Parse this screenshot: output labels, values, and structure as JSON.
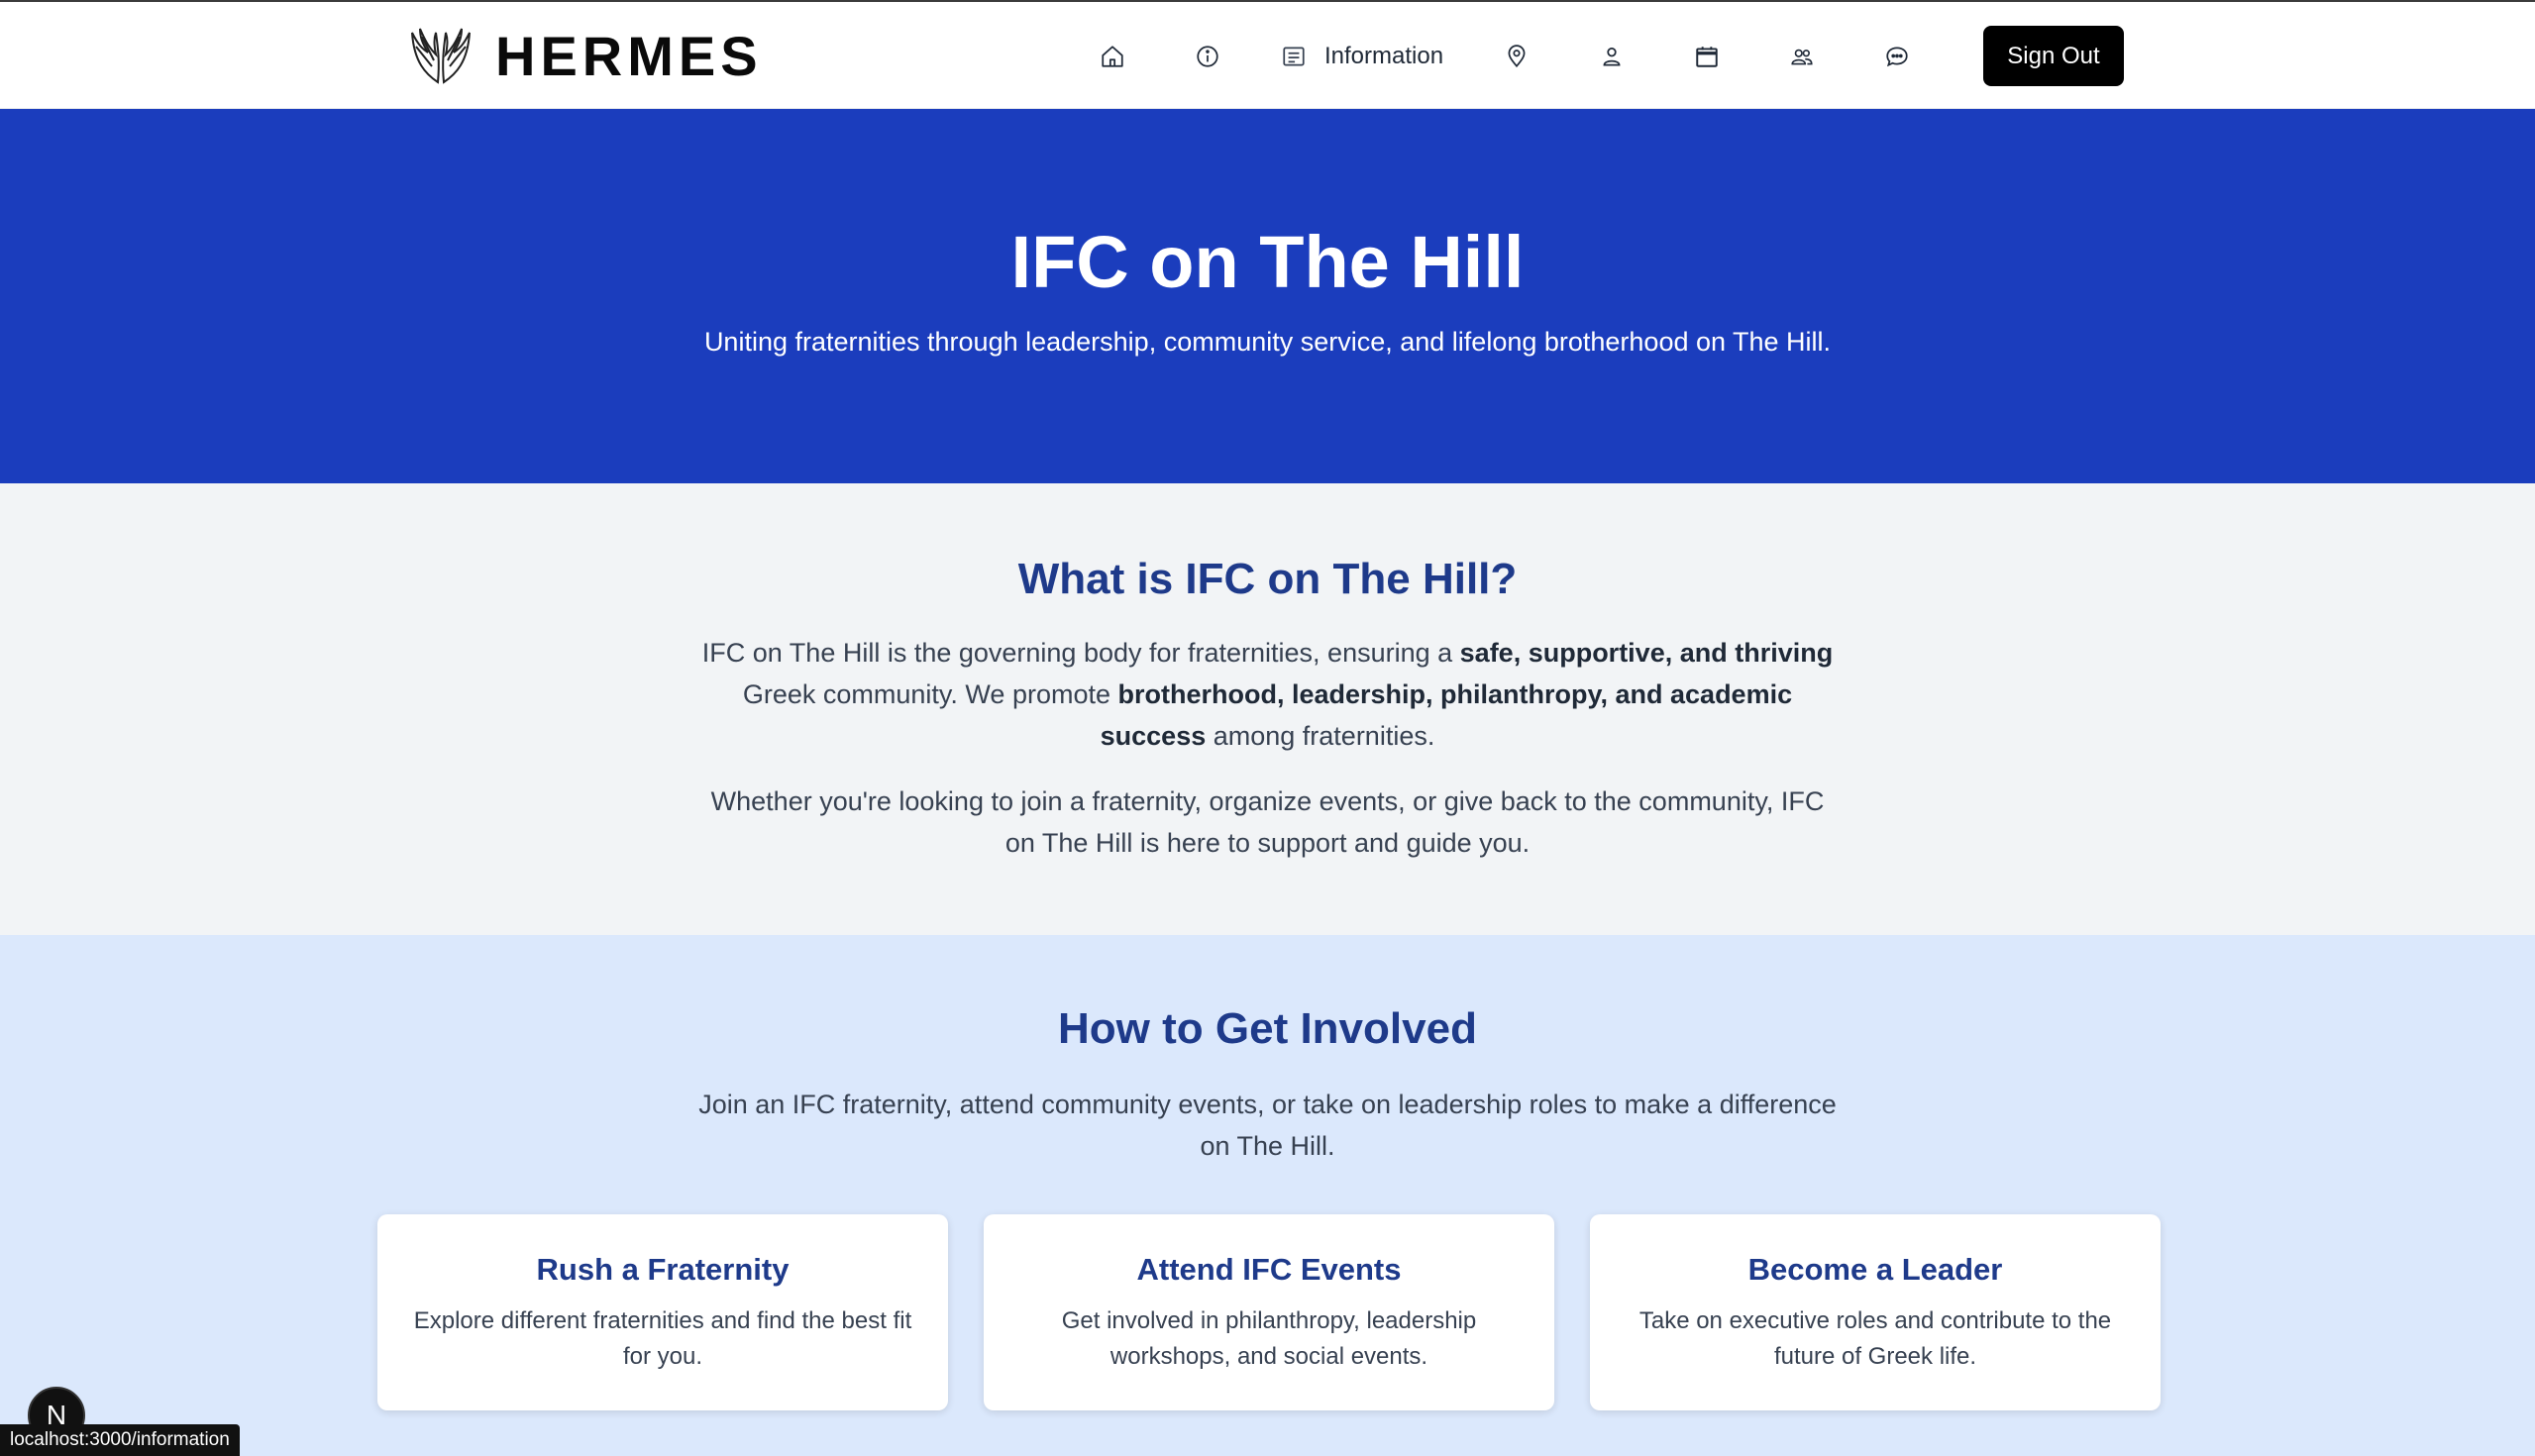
{
  "nav": {
    "logo_text": "HERMES",
    "information_label": "Information",
    "sign_out_label": "Sign Out",
    "icons": [
      "home-icon",
      "info-icon",
      "information-icon",
      "location-icon",
      "profile-icon",
      "calendar-icon",
      "groups-icon",
      "chat-icon"
    ]
  },
  "hero": {
    "title": "IFC on The Hill",
    "subtitle": "Uniting fraternities through leadership, community service, and lifelong brotherhood on The Hill."
  },
  "about": {
    "title": "What is IFC on The Hill?",
    "p1_a": "IFC on The Hill is the governing body for fraternities, ensuring a ",
    "p1_b": "safe, supportive, and thriving",
    "p1_c": " Greek community. We promote ",
    "p1_d": "brotherhood, leadership, philanthropy, and academic success",
    "p1_e": " among fraternities.",
    "p2": "Whether you're looking to join a fraternity, organize events, or give back to the community, IFC on The Hill is here to support and guide you."
  },
  "involved": {
    "title": "How to Get Involved",
    "lead": "Join an IFC fraternity, attend community events, or take on leadership roles to make a difference on The Hill.",
    "cards": [
      {
        "title": "Rush a Fraternity",
        "text": "Explore different fraternities and find the best fit for you."
      },
      {
        "title": "Attend IFC Events",
        "text": "Get involved in philanthropy, leadership workshops, and social events."
      },
      {
        "title": "Become a Leader",
        "text": "Take on executive roles and contribute to the future of Greek life."
      }
    ]
  },
  "dev": {
    "badge_letter": "N",
    "status_url": "localhost:3000/information"
  },
  "colors": {
    "hero_bg": "#1b3dbd",
    "heading": "#1e3a8a",
    "about_bg": "#f2f4f6",
    "involved_bg": "#dbe8fc"
  }
}
